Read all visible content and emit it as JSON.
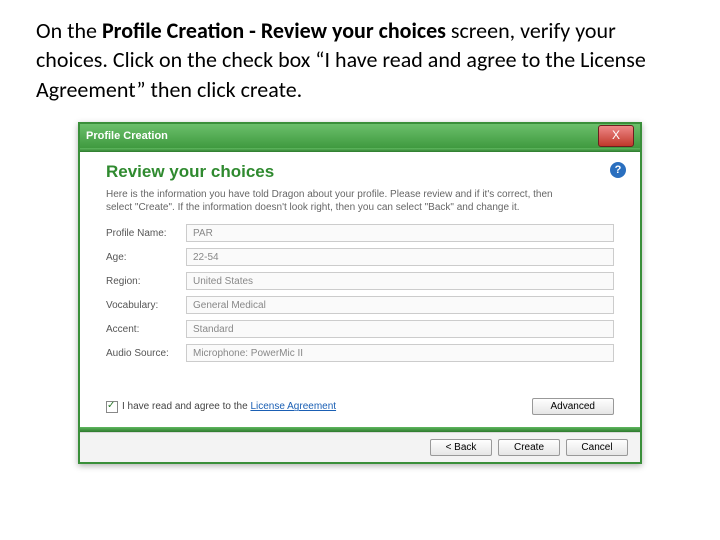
{
  "instruction": {
    "pre": "On the ",
    "bold": "Profile Creation - Review your choices",
    "post": " screen, verify your choices. Click on the check box “I have read and agree to the License Agreement” then click create."
  },
  "dialog": {
    "title": "Profile Creation",
    "close_glyph": "X",
    "help_glyph": "?",
    "heading": "Review your choices",
    "blurb": "Here is the information you have told Dragon about your profile. Please review and if it's correct, then select \"Create\". If the information doesn't look right, then you can select \"Back\" and change it.",
    "fields": [
      {
        "label": "Profile Name:",
        "value": "PAR"
      },
      {
        "label": "Age:",
        "value": "22-54"
      },
      {
        "label": "Region:",
        "value": "United States"
      },
      {
        "label": "Vocabulary:",
        "value": "General Medical"
      },
      {
        "label": "Accent:",
        "value": "Standard"
      },
      {
        "label": "Audio Source:",
        "value": "Microphone: PowerMic II"
      }
    ],
    "agree_text": "I have read and agree to the",
    "agree_link": "License Agreement",
    "advanced_label": "Advanced",
    "back_label": "< Back",
    "create_label": "Create",
    "cancel_label": "Cancel"
  }
}
